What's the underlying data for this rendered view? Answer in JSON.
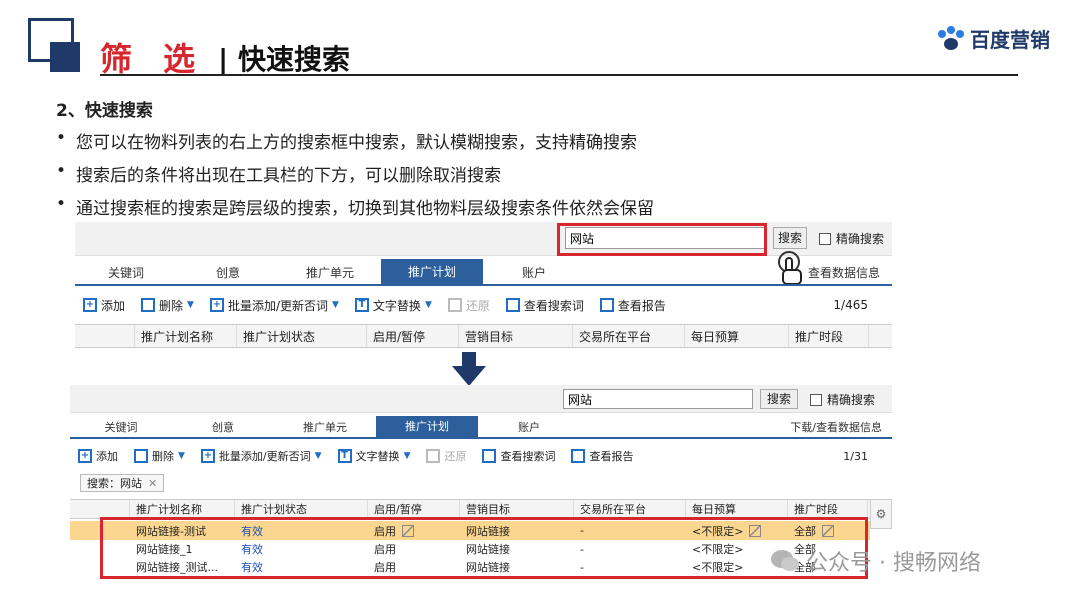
{
  "slide": {
    "title_red": "筛 选",
    "title_black": "| 快速搜索",
    "logo_text": "百度营销",
    "heading": "2、快速搜索",
    "bullets": [
      "您可以在物料列表的右上方的搜索框中搜索，默认模糊搜索，支持精确搜索",
      "搜索后的条件将出现在工具栏的下方，可以删除取消搜索",
      "通过搜索框的搜索是跨层级的搜索，切换到其他物料层级搜索条件依然会保留"
    ],
    "bullet_symbol": "•",
    "watermark": "公众号 · 搜畅网络"
  },
  "top_shot": {
    "search": {
      "value": "网站",
      "button": "搜索",
      "exact_label": "精确搜索"
    },
    "tabs": [
      "关键词",
      "创意",
      "推广单元",
      "推广计划",
      "账户"
    ],
    "active_tab": "推广计划",
    "download": "查看数据信息",
    "toolbar": {
      "add": "添加",
      "delete": "删除",
      "batch": "批量添加/更新否词",
      "replace": "文字替换",
      "restore": "还原",
      "view_search": "查看搜索词",
      "view_report": "查看报告",
      "page": "1/465"
    },
    "columns": [
      "推广计划名称",
      "推广计划状态",
      "启用/暂停",
      "营销目标",
      "交易所在平台",
      "每日预算",
      "推广时段"
    ]
  },
  "bottom_shot": {
    "search": {
      "value": "网站",
      "button": "搜索",
      "exact_label": "精确搜索"
    },
    "tabs": [
      "关键词",
      "创意",
      "推广单元",
      "推广计划",
      "账户"
    ],
    "active_tab": "推广计划",
    "download": "下载/查看数据信息",
    "toolbar": {
      "add": "添加",
      "delete": "删除",
      "batch": "批量添加/更新否词",
      "replace": "文字替换",
      "restore": "还原",
      "view_search": "查看搜索词",
      "view_report": "查看报告",
      "page": "1/31"
    },
    "filter_tag": "搜索：网站",
    "columns": [
      "推广计划名称",
      "推广计划状态",
      "启用/暂停",
      "营销目标",
      "交易所在平台",
      "每日预算",
      "推广时段"
    ],
    "rows": [
      [
        "网站链接-测试",
        "有效",
        "启用",
        "网站链接",
        "-",
        "<不限定>",
        "全部"
      ],
      [
        "网站链接_1",
        "有效",
        "启用",
        "网站链接",
        "-",
        "<不限定>",
        "全部"
      ],
      [
        "网站链接_测试...",
        "有效",
        "启用",
        "网站链接",
        "-",
        "<不限定>",
        "全部"
      ]
    ]
  },
  "colors": {
    "red": "#d8262e",
    "navy": "#1f3a68",
    "tab_active": "#2c5f9b",
    "highlight_row": "#fbd690"
  }
}
